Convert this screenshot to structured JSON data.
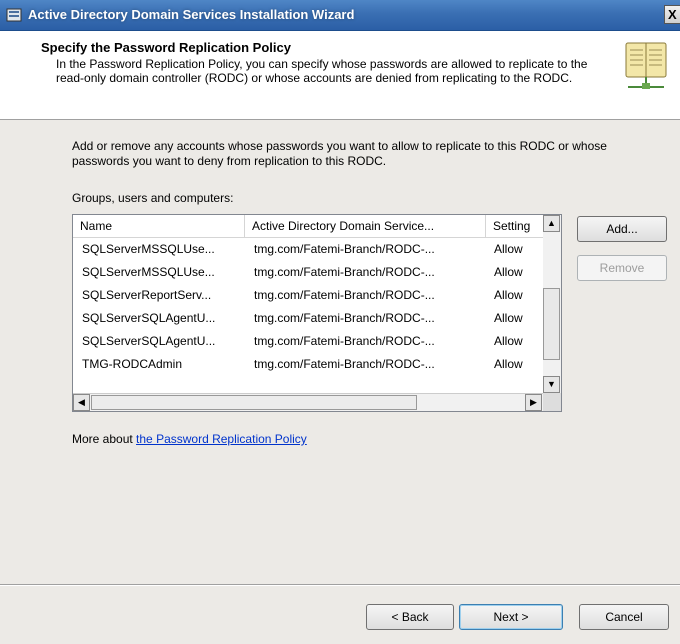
{
  "window": {
    "title": "Active Directory Domain Services Installation Wizard",
    "close_label": "X"
  },
  "header": {
    "title": "Specify the Password Replication Policy",
    "description": "In the Password Replication Policy, you can specify whose passwords are allowed to replicate to the read-only domain controller (RODC) or whose accounts are denied from replicating to the RODC."
  },
  "intro": "Add or remove any accounts whose passwords you want to allow to replicate to this RODC or whose passwords you want to deny from replication to this RODC.",
  "list_label": "Groups, users and computers:",
  "columns": [
    "Name",
    "Active Directory Domain Service...",
    "Setting"
  ],
  "rows": [
    {
      "name": "SQLServerMSSQLUse...",
      "ad": "tmg.com/Fatemi-Branch/RODC-...",
      "setting": "Allow"
    },
    {
      "name": "SQLServerMSSQLUse...",
      "ad": "tmg.com/Fatemi-Branch/RODC-...",
      "setting": "Allow"
    },
    {
      "name": "SQLServerReportServ...",
      "ad": "tmg.com/Fatemi-Branch/RODC-...",
      "setting": "Allow"
    },
    {
      "name": "SQLServerSQLAgentU...",
      "ad": "tmg.com/Fatemi-Branch/RODC-...",
      "setting": "Allow"
    },
    {
      "name": "SQLServerSQLAgentU...",
      "ad": "tmg.com/Fatemi-Branch/RODC-...",
      "setting": "Allow"
    },
    {
      "name": "TMG-RODCAdmin",
      "ad": "tmg.com/Fatemi-Branch/RODC-...",
      "setting": "Allow"
    }
  ],
  "buttons": {
    "add": "Add...",
    "remove": "Remove",
    "back": "< Back",
    "next": "Next >",
    "cancel": "Cancel"
  },
  "more": {
    "prefix": "More about ",
    "link": "the Password Replication Policy"
  },
  "colors": {
    "titlebar": "#3a6fb3",
    "link": "#0033cc",
    "body_bg": "#eceae6"
  }
}
